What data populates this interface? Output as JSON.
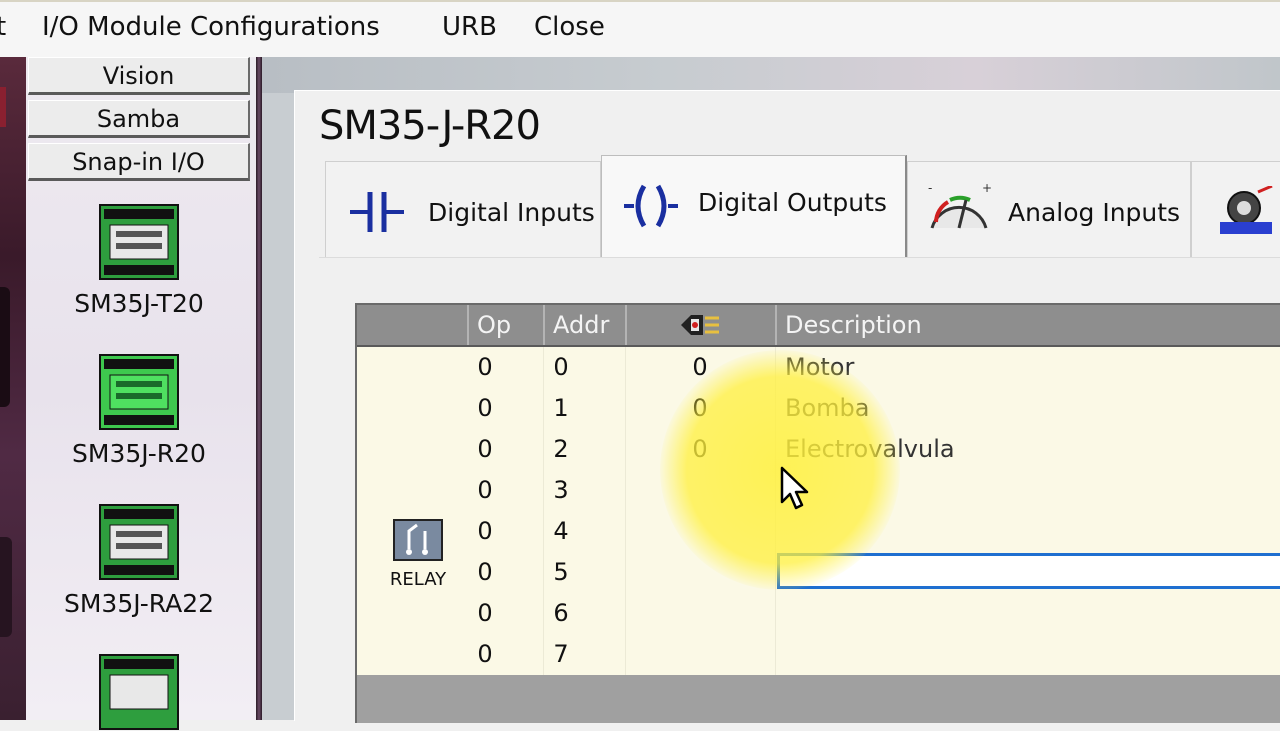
{
  "menu": {
    "items": [
      {
        "label": "t"
      },
      {
        "label": "I/O Module Configurations"
      },
      {
        "label": "URB"
      },
      {
        "label": "Close"
      }
    ]
  },
  "palette": {
    "buttons": [
      "Vision",
      "Samba",
      "Snap-in I/O"
    ],
    "modules": [
      {
        "label": "SM35J-T20"
      },
      {
        "label": "SM35J-R20",
        "selected": true
      },
      {
        "label": "SM35J-RA22"
      }
    ]
  },
  "dialog": {
    "title": "SM35-J-R20",
    "tabs": [
      {
        "label": "Digital Inputs",
        "icon": "contact-icon"
      },
      {
        "label": "Digital Outputs",
        "icon": "coil-icon",
        "active": true
      },
      {
        "label": "Analog Inputs",
        "icon": "gauge-icon"
      },
      {
        "label": "",
        "icon": "config-icon"
      }
    ]
  },
  "grid": {
    "headers": [
      "Op",
      "Addr",
      "",
      "Description"
    ],
    "header_icon": "output-state-icon",
    "type_label": "RELAY",
    "rows": [
      {
        "op": "0",
        "addr": "0",
        "state": "0",
        "desc": "Motor"
      },
      {
        "op": "0",
        "addr": "1",
        "state": "0",
        "desc": "Bomba"
      },
      {
        "op": "0",
        "addr": "2",
        "state": "0",
        "desc": "Electrovalvula"
      },
      {
        "op": "0",
        "addr": "3",
        "state": "",
        "desc": ""
      },
      {
        "op": "0",
        "addr": "4",
        "state": "",
        "desc": ""
      },
      {
        "op": "0",
        "addr": "5",
        "state": "",
        "desc": ""
      },
      {
        "op": "0",
        "addr": "6",
        "state": "",
        "desc": ""
      },
      {
        "op": "0",
        "addr": "7",
        "state": "",
        "desc": ""
      }
    ]
  },
  "colors": {
    "grid_body": "#fbf9e6",
    "header": "#8e8e8e",
    "edit_border": "#1f6fd0",
    "icon_blue": "#1a2fa0",
    "chip_green": "#2e9e3e"
  }
}
